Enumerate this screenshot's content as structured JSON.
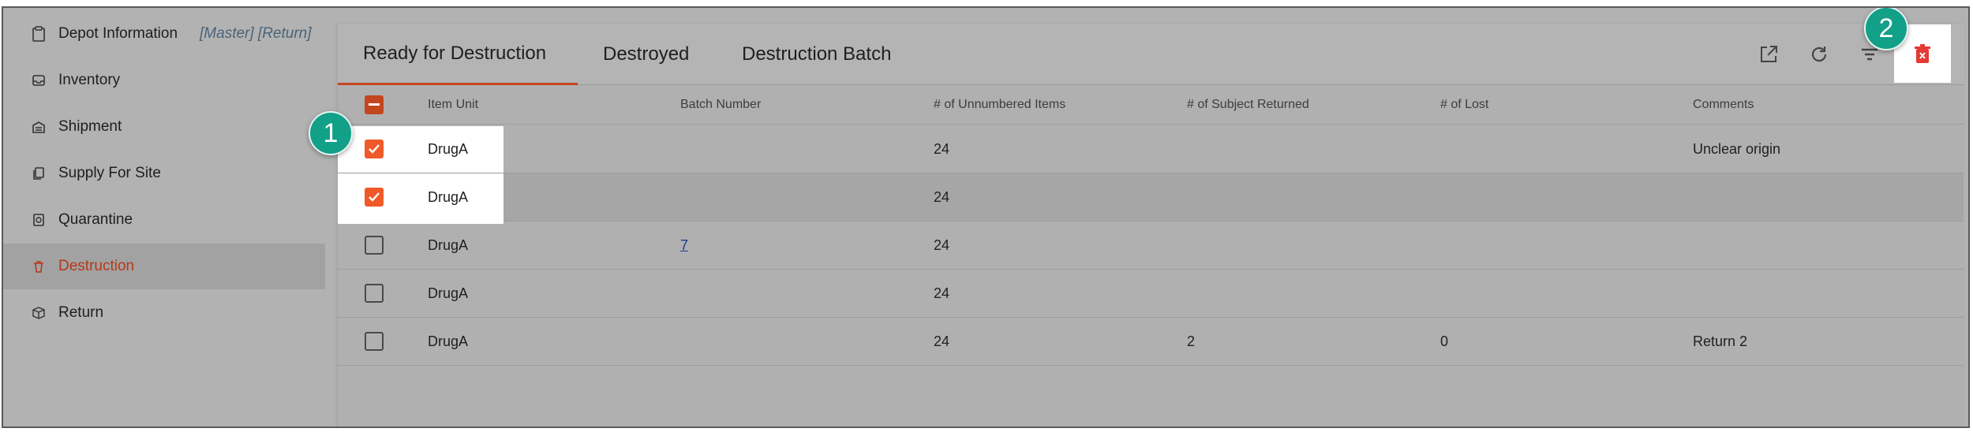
{
  "sidebar": {
    "items": [
      {
        "label": "Depot Information",
        "icon": "clipboard-icon"
      },
      {
        "label": "Inventory",
        "icon": "inbox-icon"
      },
      {
        "label": "Shipment",
        "icon": "warehouse-icon"
      },
      {
        "label": "Supply For Site",
        "icon": "copy-icon"
      },
      {
        "label": "Quarantine",
        "icon": "quarantine-icon"
      },
      {
        "label": "Destruction",
        "icon": "trash-icon",
        "active": true
      },
      {
        "label": "Return",
        "icon": "box-icon"
      }
    ],
    "tags": "[Master] [Return]"
  },
  "tabs": [
    {
      "label": "Ready for Destruction",
      "active": true
    },
    {
      "label": "Destroyed"
    },
    {
      "label": "Destruction Batch"
    }
  ],
  "toolbar": [
    "open-in-new-icon",
    "refresh-icon",
    "filter-icon",
    "delete-icon"
  ],
  "table": {
    "columns": [
      "Item Unit",
      "Batch Number",
      "# of Unnumbered Items",
      "# of Subject Returned",
      "# of Lost",
      "Comments"
    ],
    "rows": [
      {
        "checked": true,
        "item_unit": "DrugA",
        "batch_number": "",
        "unnumbered": "24",
        "subject_returned": "",
        "lost": "",
        "comments": "Unclear origin"
      },
      {
        "checked": true,
        "item_unit": "DrugA",
        "batch_number": "",
        "unnumbered": "24",
        "subject_returned": "",
        "lost": "",
        "comments": ""
      },
      {
        "checked": false,
        "item_unit": "DrugA",
        "batch_number": "7",
        "unnumbered": "24",
        "subject_returned": "",
        "lost": "",
        "comments": ""
      },
      {
        "checked": false,
        "item_unit": "DrugA",
        "batch_number": "",
        "unnumbered": "24",
        "subject_returned": "",
        "lost": "",
        "comments": ""
      },
      {
        "checked": false,
        "item_unit": "DrugA",
        "batch_number": "",
        "unnumbered": "24",
        "subject_returned": "2",
        "lost": "0",
        "comments": "Return 2"
      }
    ]
  },
  "callouts": [
    "1",
    "2"
  ],
  "colors": {
    "accent": "#c4461f",
    "checkbox": "#f05a28",
    "badge": "#12a089",
    "delete": "#e53935"
  }
}
